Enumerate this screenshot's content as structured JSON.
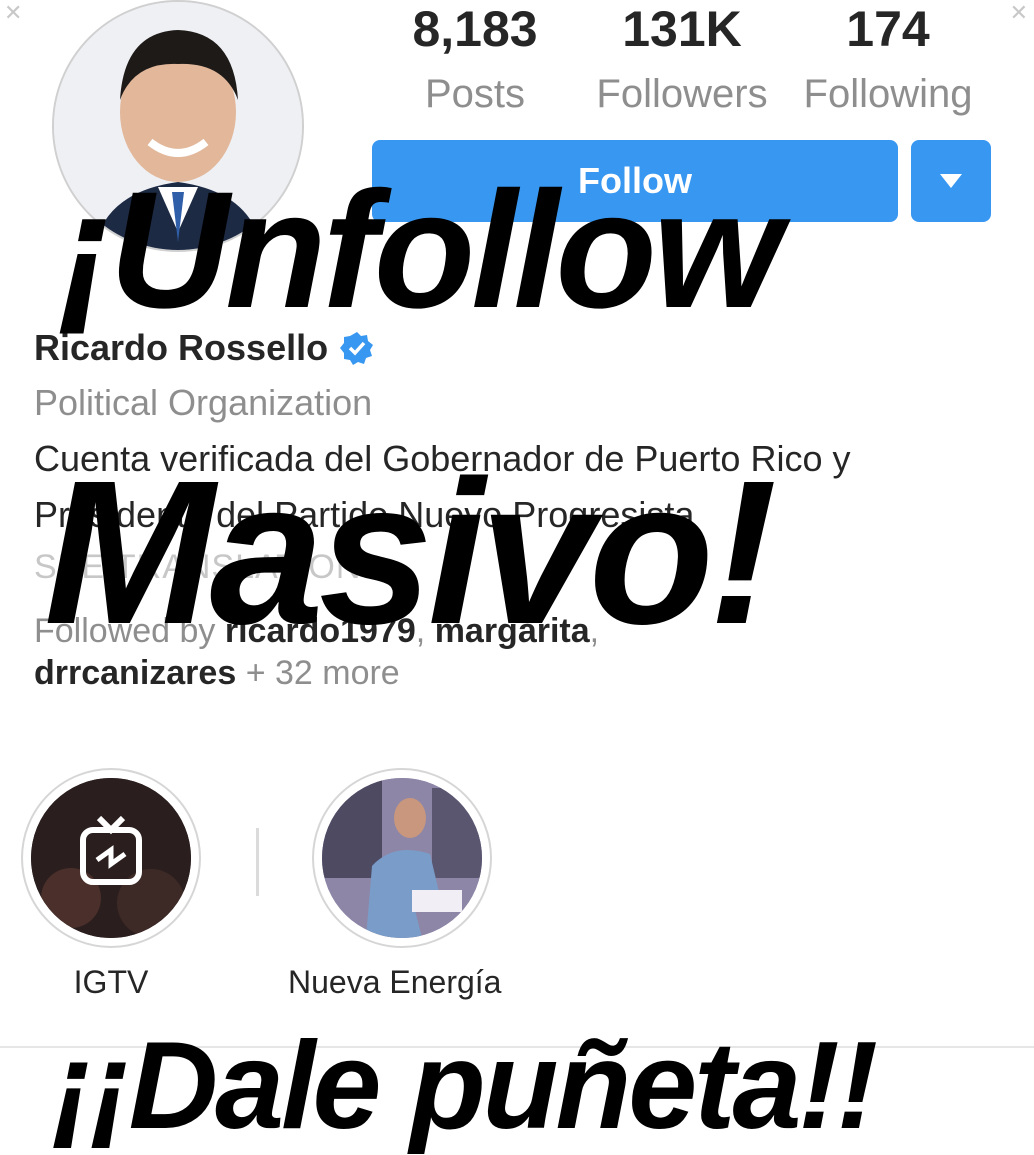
{
  "profile": {
    "stats": [
      {
        "value": "8,183",
        "label": "Posts"
      },
      {
        "value": "131K",
        "label": "Followers"
      },
      {
        "value": "174",
        "label": "Following"
      }
    ],
    "follow_label": "Follow",
    "name": "Ricardo Rossello",
    "category": "Political Organization",
    "bio_line1": "Cuenta verificada del Gobernador de Puerto Rico y",
    "bio_line2": "Presidente del Partido Nuevo Progresista",
    "see_translation": "SEE TRANSLATION",
    "followed_by_prefix": "Followed by",
    "followed_by_user1": "ricardo1979",
    "followed_by_user2": "margarita",
    "followed_by_user3": "drrcanizares",
    "followed_by_more": "+ 32 more"
  },
  "highlights": [
    {
      "label": "IGTV",
      "icon": "igtv-icon"
    },
    {
      "label": "Nueva Energía",
      "icon": "photo-thumbnail"
    }
  ],
  "overlay": {
    "line1": "¡Unfollow",
    "line2": "Masivo!",
    "line3": "¡¡Dale puñeta!!"
  },
  "colors": {
    "accent": "#3897f0",
    "verified": "#3897f0",
    "text": "#262626",
    "muted": "#8e8e8e"
  }
}
